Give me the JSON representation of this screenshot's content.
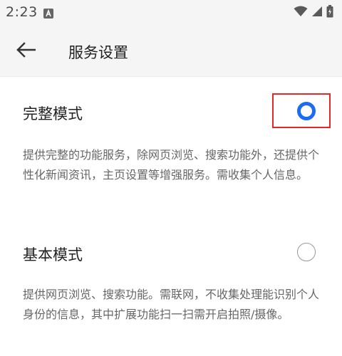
{
  "status_bar": {
    "time": "2:23",
    "icons": [
      "a-notification-icon",
      "wifi-icon",
      "signal-icon",
      "battery-icon"
    ]
  },
  "header": {
    "title": "服务设置",
    "back_icon": "back-arrow-icon"
  },
  "options": [
    {
      "title": "完整模式",
      "selected": true,
      "description": "提供完整的功能服务，除网页浏览、搜索功能外，还提供个性化新闻资讯，主页设置等增强服务。需收集个人信息。"
    },
    {
      "title": "基本模式",
      "selected": false,
      "description": "提供网页浏览、搜索功能。需联网，不收集处理能识别个人身份的信息，其中扩展功能扫一扫需开启拍照/摄像。"
    }
  ],
  "colors": {
    "accent": "#1a6bf5",
    "highlight": "#e52727",
    "background": "#ffffff",
    "bar_background": "#f5f5f5"
  }
}
